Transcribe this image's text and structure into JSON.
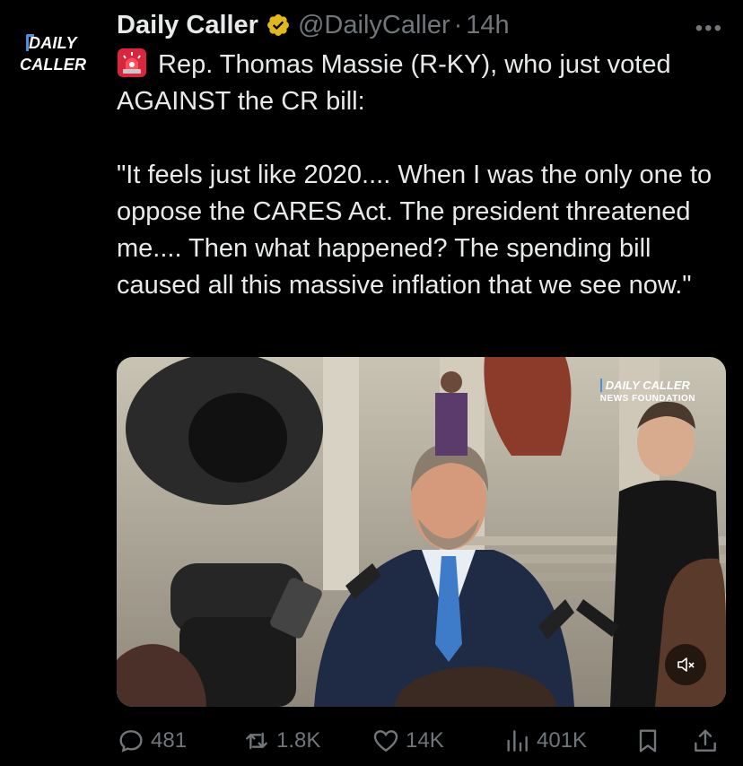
{
  "account": {
    "logo_line1": "DAILY",
    "logo_line2": "CALLER",
    "name": "Daily Caller",
    "handle": "@DailyCaller",
    "separator": "·",
    "time": "14h",
    "verified_icon": "gold-verified-badge",
    "verified_color": "#e2b719"
  },
  "tweet": {
    "line1": "Rep. Thomas Massie (R-KY), who just voted AGAINST the CR bill:",
    "quote": "\"It feels just like 2020.... When I was the only one to oppose the CARES Act. The president threatened me.... Then what happened? The spending bill caused all this massive inflation that we see now.\"",
    "emoji_icon": "police-siren-icon"
  },
  "media": {
    "watermark_line1": "DAILY CALLER",
    "watermark_line2": "NEWS FOUNDATION",
    "mute_icon": "muted-speaker-icon"
  },
  "actions": {
    "replies": "481",
    "retweets": "1.8K",
    "likes": "14K",
    "views": "401K"
  },
  "colors": {
    "background": "#000000",
    "text": "#e7e9ea",
    "muted": "#71767b",
    "brand_blue": "#4a90e2",
    "brand_red": "#e0245e"
  }
}
